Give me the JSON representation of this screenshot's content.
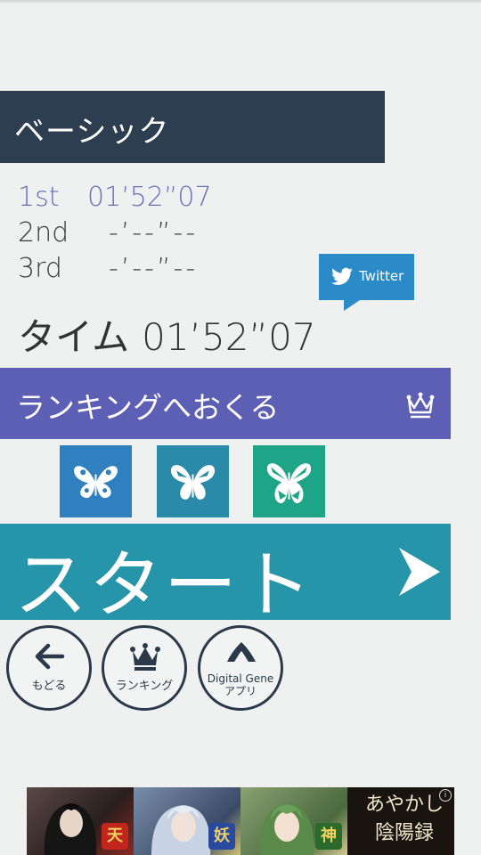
{
  "mode": {
    "title": "ベーシック"
  },
  "records": [
    {
      "place": "1st",
      "time": "01’52”07",
      "best": true
    },
    {
      "place": "2nd",
      "time": "-’--”--",
      "best": false
    },
    {
      "place": "3rd",
      "time": "-’--”--",
      "best": false
    }
  ],
  "twitter": {
    "label": "Twitter"
  },
  "result": {
    "label": "タイム",
    "time": "01’52”07"
  },
  "ranking_send": {
    "label": "ランキングへおくる"
  },
  "difficulty": [
    {
      "name": "butterfly-1",
      "color": "#3080c0"
    },
    {
      "name": "butterfly-2",
      "color": "#2a8ba8"
    },
    {
      "name": "butterfly-3",
      "color": "#1ea486"
    }
  ],
  "start": {
    "label": "スタート"
  },
  "nav": {
    "back": "もどる",
    "ranking": "ランキング",
    "apps_line1": "Digital Gene",
    "apps_line2": "アプリ"
  },
  "ad": {
    "title_line1": "あやかし",
    "title_line2": "陰陽録",
    "badge1": "天",
    "badge2": "妖",
    "badge3": "神",
    "info": "i"
  },
  "colors": {
    "header": "#2c3e50",
    "ranking": "#5c5fb3",
    "start": "#2694a9",
    "twitter": "#2b8bc9"
  }
}
